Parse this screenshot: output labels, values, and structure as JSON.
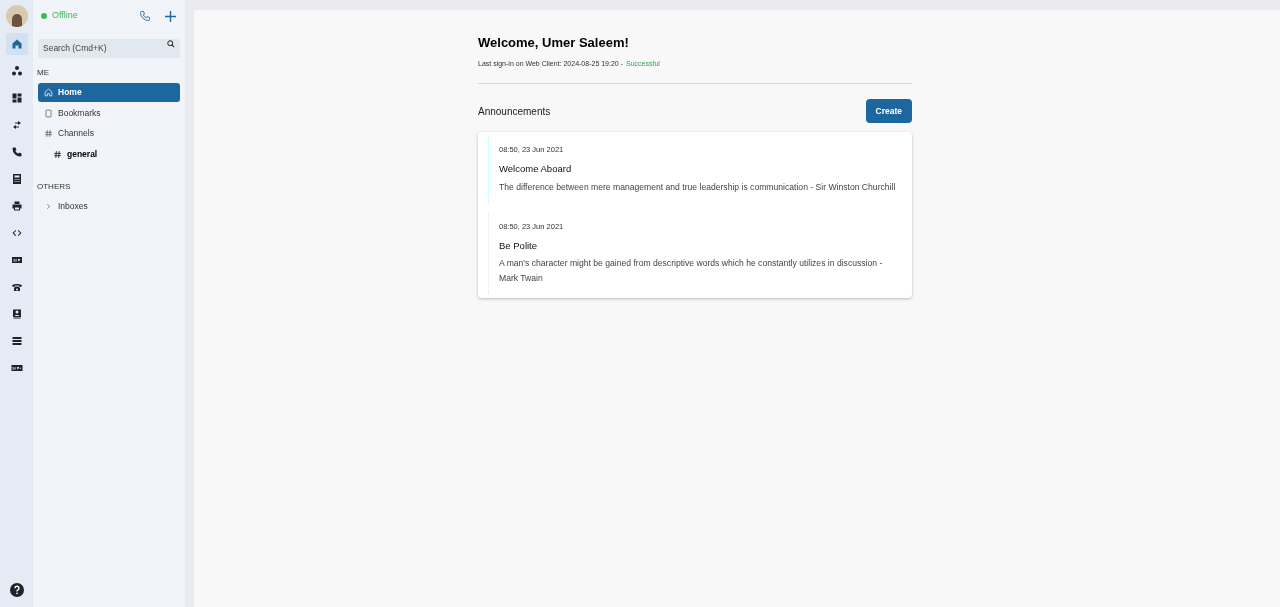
{
  "rail": {
    "items": [
      {
        "kind": "home",
        "selected": true
      },
      {
        "kind": "nodes",
        "selected": false
      },
      {
        "kind": "dashboard",
        "selected": false
      },
      {
        "kind": "transfer",
        "selected": false
      },
      {
        "kind": "phone",
        "selected": false
      },
      {
        "kind": "calculator",
        "selected": false
      },
      {
        "kind": "printer",
        "selected": false
      },
      {
        "kind": "code",
        "selected": false
      },
      {
        "kind": "sip",
        "selected": false
      },
      {
        "kind": "telephone",
        "selected": false
      },
      {
        "kind": "contact",
        "selected": false
      },
      {
        "kind": "stack",
        "selected": false
      },
      {
        "kind": "sipplus",
        "selected": false
      }
    ]
  },
  "sidebar": {
    "status": "Offline",
    "search": {
      "placeholder": "Search (Cmd+K)"
    },
    "sections": [
      {
        "title": "ME",
        "items": [
          {
            "kind": "home",
            "label": "Home",
            "selected": true
          },
          {
            "kind": "bookmark",
            "label": "Bookmarks",
            "selected": false
          },
          {
            "kind": "hash",
            "label": "Channels",
            "selected": false,
            "children": [
              {
                "kind": "hash",
                "label": "general",
                "selected": false
              }
            ]
          }
        ]
      },
      {
        "title": "OTHERS",
        "items": [
          {
            "kind": "chevron",
            "label": "Inboxes",
            "selected": false
          }
        ]
      }
    ]
  },
  "main": {
    "title": "Welcome, Umer Saleem!",
    "last_signin": "Last sign-in on Web Client: 2024-08-25 19:20 -",
    "signin_status": "Successful",
    "announcements_title": "Announcements",
    "create_button": "Create",
    "announcements": [
      {
        "time": "08:50, 23 Jun 2021",
        "title": "Welcome Aboard",
        "body": "The difference between mere management and true leadership is communication - Sir Winston Churchill"
      },
      {
        "time": "08:50, 23 Jun 2021",
        "title": "Be Polite",
        "body": "A man's character might be gained from descriptive words which he constantly utilizes in discussion - Mark Twain"
      }
    ]
  }
}
